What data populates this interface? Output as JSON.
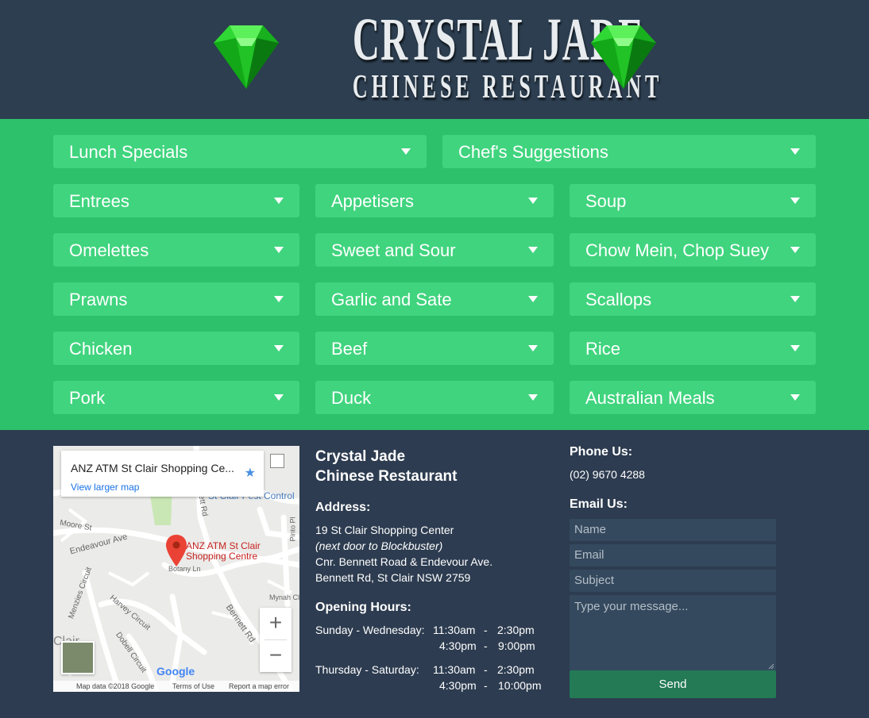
{
  "header": {
    "logo_line1": "CRYSTAL JADE",
    "logo_line2": "CHINESE RESTAURANT",
    "gem_icon": "emerald-gem-icon"
  },
  "colors": {
    "header_bg": "#2c3e50",
    "menu_band_bg": "#2ec16c",
    "menu_button_bg": "#40d47e",
    "footer_bg": "#2d3c50",
    "field_bg": "#34495e",
    "send_bg": "#237a55"
  },
  "menu": {
    "row1": [
      {
        "label": "Lunch Specials"
      },
      {
        "label": "Chef's Suggestions"
      }
    ],
    "grid": [
      {
        "label": "Entrees"
      },
      {
        "label": "Appetisers"
      },
      {
        "label": "Soup"
      },
      {
        "label": "Omelettes"
      },
      {
        "label": "Sweet and Sour"
      },
      {
        "label": "Chow Mein, Chop Suey"
      },
      {
        "label": "Prawns"
      },
      {
        "label": "Garlic and Sate"
      },
      {
        "label": "Scallops"
      },
      {
        "label": "Chicken"
      },
      {
        "label": "Beef"
      },
      {
        "label": "Rice"
      },
      {
        "label": "Pork"
      },
      {
        "label": "Duck"
      },
      {
        "label": "Australian Meals"
      }
    ]
  },
  "map": {
    "place_name": "ANZ ATM St Clair Shopping Ce...",
    "view_larger": "View larger map",
    "pin_label_line1": "ANZ ATM St Clair",
    "pin_label_line2": "Shopping Centre",
    "zoom_in": "+",
    "zoom_out": "−",
    "google": "Google",
    "attrib_data": "Map data ©2018 Google",
    "attrib_terms": "Terms of Use",
    "attrib_report": "Report a map error",
    "street_labels": {
      "endeavour": "Endeavour Ave",
      "moore": "Moore St",
      "botany": "Botany Ln",
      "harvey": "Harvey Circuit",
      "menzies": "Menzies Circuit",
      "bennett": "Bennett Rd",
      "dobell": "Dobell Circuit",
      "mynah": "Mynah Cl",
      "pinto": "Pinto Pl",
      "pest_control": "St Clair Pest Control",
      "rd": "ett Rd",
      "clair": "Clair"
    }
  },
  "info": {
    "name_line1": "Crystal Jade",
    "name_line2": "Chinese Restaurant",
    "address_heading": "Address:",
    "address_lines": [
      "19 St Clair Shopping Center",
      "(next door to Blockbuster)",
      "Cnr. Bennett Road & Endevour Ave.",
      "Bennett Rd, St Clair NSW 2759"
    ],
    "hours_heading": "Opening Hours:",
    "hours": [
      {
        "days": "Sunday - Wednesday:",
        "open1": "11:30am",
        "close1": "2:30pm",
        "open2": "4:30pm",
        "close2": "9:00pm"
      },
      {
        "days": "Thursday - Saturday:",
        "open1": "11:30am",
        "close1": "2:30pm",
        "open2": "4:30pm",
        "close2": "10:00pm"
      }
    ],
    "dash": "-"
  },
  "contact": {
    "phone_heading": "Phone Us:",
    "phone": "(02) 9670 4288",
    "email_heading": "Email Us:",
    "name_placeholder": "Name",
    "email_placeholder": "Email",
    "subject_placeholder": "Subject",
    "message_placeholder": "Type your message...",
    "send_label": "Send"
  }
}
